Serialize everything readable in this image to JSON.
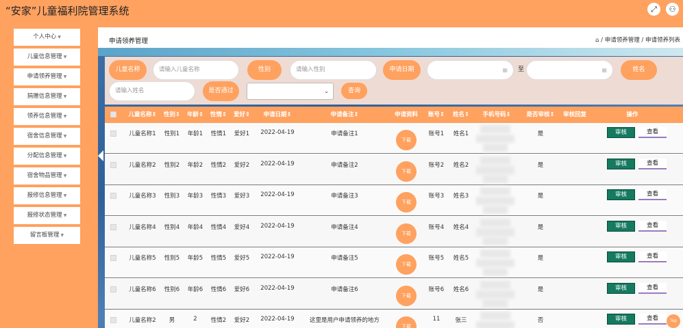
{
  "app": {
    "title": "“安家”儿童福利院管理系统"
  },
  "topbar": {
    "fullscreen_icon": "expand-icon",
    "user_icon": "user-icon"
  },
  "sidebar": {
    "items": [
      {
        "label": "个人中心"
      },
      {
        "label": "儿童信息管理"
      },
      {
        "label": "申请领养管理"
      },
      {
        "label": "捐赠信息管理"
      },
      {
        "label": "领养信息管理"
      },
      {
        "label": "宿舍信息管理"
      },
      {
        "label": "分配信息管理"
      },
      {
        "label": "宿舍物品管理"
      },
      {
        "label": "报修信息管理"
      },
      {
        "label": "报修状态管理"
      },
      {
        "label": "留言板管理"
      }
    ]
  },
  "page": {
    "title": "申请领养管理",
    "breadcrumb": "⌂ / 申请领养管理 / 申请领养列表"
  },
  "search": {
    "name_label": "儿童名称",
    "name_placeholder": "请输入儿童名称",
    "gender_label": "性别",
    "gender_placeholder": "请输入性别",
    "date_label": "申请日期",
    "date_to": "至",
    "realname_label": "姓名",
    "realname_placeholder": "请输入姓名",
    "pass_label": "是否通过",
    "pass_select": "⌄",
    "query_button": "查询"
  },
  "table": {
    "headers": [
      "儿童名称⇕",
      "性别⇕",
      "年龄⇕",
      "性情⇕",
      "爱好⇕",
      "申请日期⇕",
      "申请备注⇕",
      "申请资料",
      "账号⇕",
      "姓名⇕",
      "手机号码⇕",
      "是否审核⇕",
      "审核回复",
      "操作"
    ],
    "download_label": "下载",
    "review_label": "审核",
    "view_label": "查看",
    "rows": [
      {
        "name": "儿童名称1",
        "gender": "性别1",
        "age": "年龄1",
        "temper": "性情1",
        "hobby": "爱好1",
        "date": "2022-04-19",
        "remark": "申请备注1",
        "account": "账号1",
        "realname": "姓名1",
        "reviewed": "是"
      },
      {
        "name": "儿童名称2",
        "gender": "性别2",
        "age": "年龄2",
        "temper": "性情2",
        "hobby": "爱好2",
        "date": "2022-04-19",
        "remark": "申请备注2",
        "account": "账号2",
        "realname": "姓名2",
        "reviewed": "是"
      },
      {
        "name": "儿童名称3",
        "gender": "性别3",
        "age": "年龄3",
        "temper": "性情3",
        "hobby": "爱好3",
        "date": "2022-04-19",
        "remark": "申请备注3",
        "account": "账号3",
        "realname": "姓名3",
        "reviewed": "是"
      },
      {
        "name": "儿童名称4",
        "gender": "性别4",
        "age": "年龄4",
        "temper": "性情4",
        "hobby": "爱好4",
        "date": "2022-04-19",
        "remark": "申请备注4",
        "account": "账号4",
        "realname": "姓名4",
        "reviewed": "是"
      },
      {
        "name": "儿童名称5",
        "gender": "性别5",
        "age": "年龄5",
        "temper": "性情5",
        "hobby": "爱好5",
        "date": "2022-04-19",
        "remark": "申请备注5",
        "account": "账号5",
        "realname": "姓名5",
        "reviewed": "是"
      },
      {
        "name": "儿童名称6",
        "gender": "性别6",
        "age": "年龄6",
        "temper": "性情6",
        "hobby": "爱好6",
        "date": "2022-04-19",
        "remark": "申请备注6",
        "account": "账号6",
        "realname": "姓名6",
        "reviewed": "是"
      },
      {
        "name": "儿童名称2",
        "gender": "男",
        "age": "2",
        "temper": "性情2",
        "hobby": "爱好2",
        "date": "2022-04-19",
        "remark": "这里是用户申请领养的地方",
        "account": "11",
        "realname": "张三",
        "reviewed": "否"
      }
    ]
  },
  "scroll_top": "Top",
  "colors": {
    "accent": "#ffa15f",
    "review_button": "#147a60",
    "panel": "#eedbd3"
  }
}
